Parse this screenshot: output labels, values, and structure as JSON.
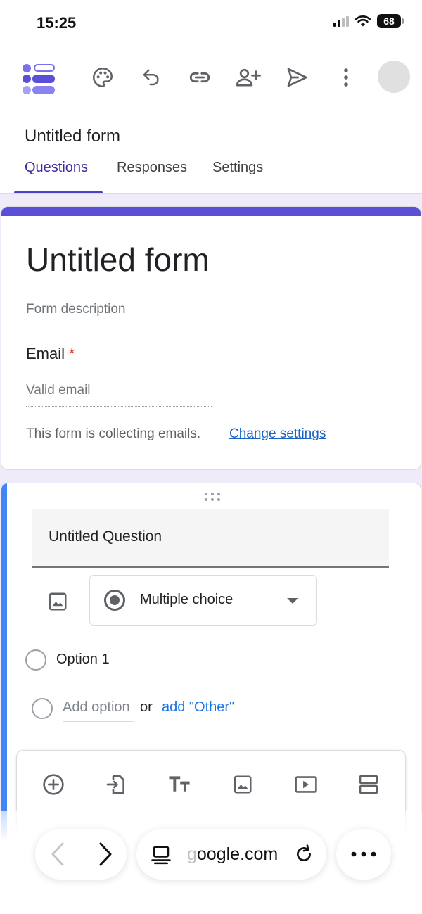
{
  "status_bar": {
    "time": "15:25",
    "battery": "68"
  },
  "toolbar": {
    "icons": [
      "forms-logo-icon",
      "palette-icon",
      "undo-icon",
      "link-icon",
      "add-collaborator-icon",
      "send-icon",
      "more-vert-icon",
      "avatar"
    ]
  },
  "document": {
    "title": "Untitled form"
  },
  "tabs": [
    {
      "label": "Questions",
      "active": true
    },
    {
      "label": "Responses",
      "active": false
    },
    {
      "label": "Settings",
      "active": false
    }
  ],
  "header_card": {
    "title": "Untitled form",
    "description_placeholder": "Form description",
    "email_label": "Email",
    "required_mark": "*",
    "email_placeholder": "Valid email",
    "collecting_note": "This form is collecting emails.",
    "change_settings_link": "Change settings"
  },
  "question_card": {
    "title": "Untitled Question",
    "type": "Multiple choice",
    "options": [
      "Option 1"
    ],
    "add_option": "Add option",
    "or": "or",
    "add_other": "add \"Other\""
  },
  "floating_toolbar": {
    "icons": [
      "add-question-icon",
      "import-questions-icon",
      "add-title-icon",
      "add-image-icon",
      "add-video-icon",
      "add-section-icon"
    ]
  },
  "browser": {
    "url": "oogle.com",
    "url_fade_prefix": "g"
  },
  "colors": {
    "theme": "#5b4fd8",
    "background": "#f0ebf8",
    "active_tab": "#4527a0",
    "question_accent": "#4285f4",
    "link": "#1a62c4"
  }
}
